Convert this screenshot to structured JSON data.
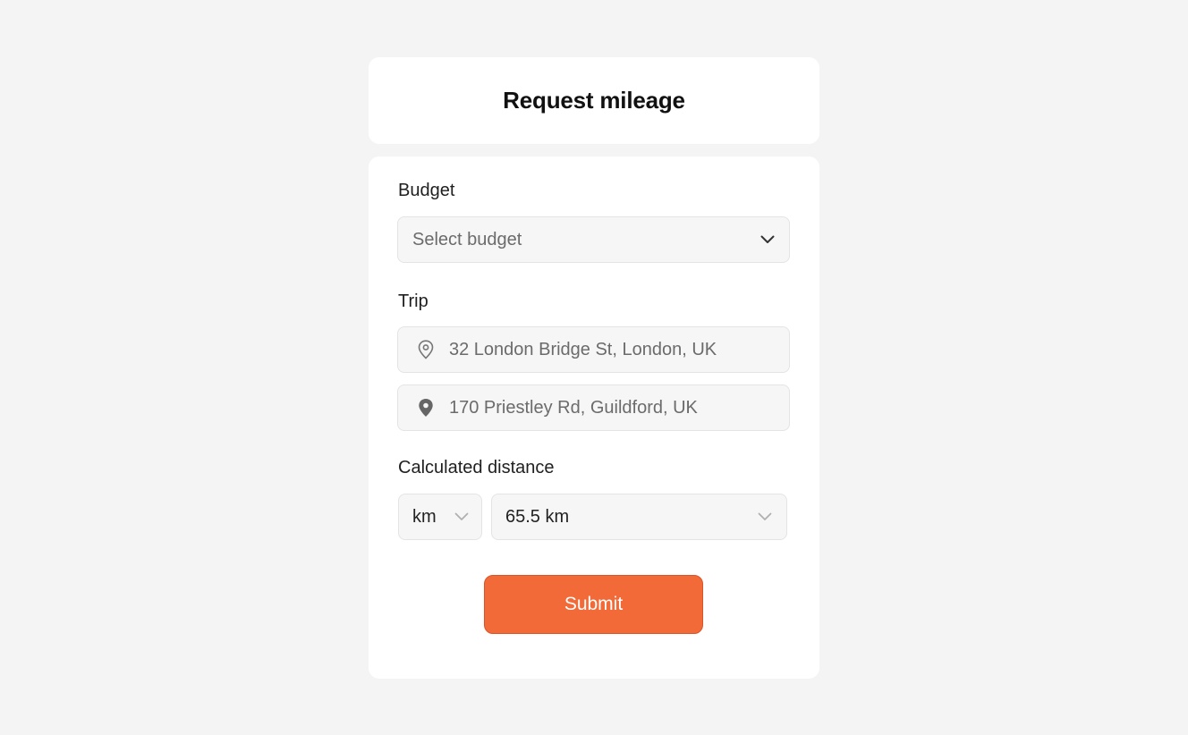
{
  "header": {
    "title": "Request mileage"
  },
  "form": {
    "budget": {
      "label": "Budget",
      "placeholder": "Select budget",
      "icon": "chevron-down-icon"
    },
    "trip": {
      "label": "Trip",
      "origin": {
        "value": "32 London Bridge St, London, UK",
        "icon": "map-pin-outline-icon"
      },
      "destination": {
        "value": "170 Priestley Rd, Guildford, UK",
        "icon": "map-pin-filled-icon"
      }
    },
    "distance": {
      "label": "Calculated distance",
      "unit": "km",
      "value": "65.5 km"
    },
    "submit_label": "Submit"
  },
  "colors": {
    "background": "#f4f4f4",
    "card": "#ffffff",
    "field": "#f6f6f6",
    "accent": "#f26a38"
  }
}
